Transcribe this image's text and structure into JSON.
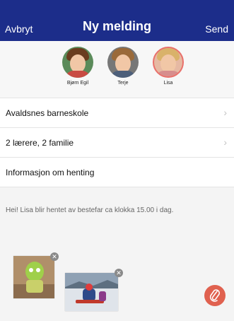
{
  "nav": {
    "cancel": "Avbryt",
    "title": "Ny melding",
    "send": "Send"
  },
  "recipients": [
    {
      "name": "Bjørn Egil",
      "selected": false
    },
    {
      "name": "Terje",
      "selected": false
    },
    {
      "name": "Lisa",
      "selected": true
    }
  ],
  "rows": [
    {
      "label": "Avaldsnes barneskole",
      "chevron": true
    },
    {
      "label": "2 lærere, 2 familie",
      "chevron": true
    },
    {
      "label": "Informasjon om henting",
      "chevron": false
    }
  ],
  "message": "Hei! Lisa blir hentet av bestefar ca klokka 15.00 i dag.",
  "attachments": [
    {
      "type": "photo",
      "remove_icon": "close-icon"
    },
    {
      "type": "photo",
      "remove_icon": "close-icon"
    }
  ],
  "fab": {
    "icon": "paperclip-icon"
  },
  "colors": {
    "nav_bg": "#1c2d8a",
    "accent": "#e0614f",
    "selected_ring": "#e9706b"
  }
}
